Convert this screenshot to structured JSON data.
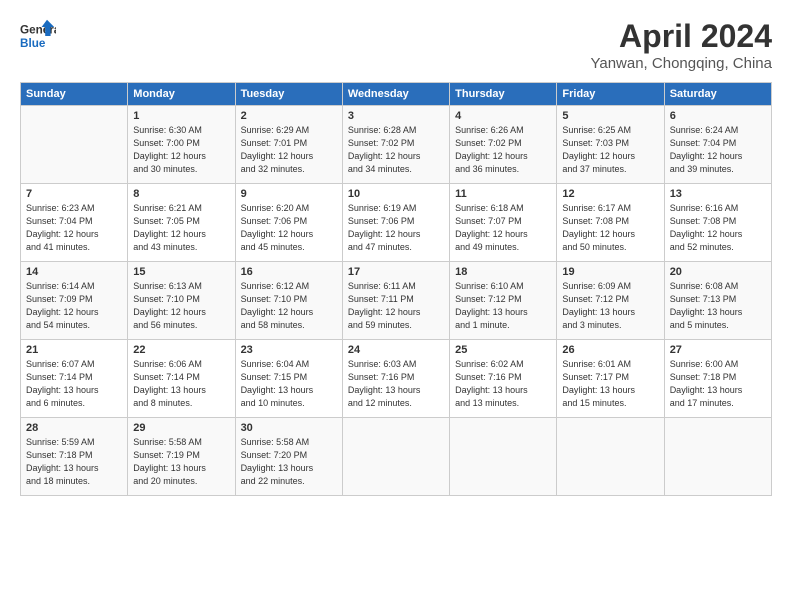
{
  "header": {
    "logo_line1": "General",
    "logo_line2": "Blue",
    "title": "April 2024",
    "subtitle": "Yanwan, Chongqing, China"
  },
  "columns": [
    "Sunday",
    "Monday",
    "Tuesday",
    "Wednesday",
    "Thursday",
    "Friday",
    "Saturday"
  ],
  "weeks": [
    [
      {
        "day": "",
        "info": ""
      },
      {
        "day": "1",
        "info": "Sunrise: 6:30 AM\nSunset: 7:00 PM\nDaylight: 12 hours\nand 30 minutes."
      },
      {
        "day": "2",
        "info": "Sunrise: 6:29 AM\nSunset: 7:01 PM\nDaylight: 12 hours\nand 32 minutes."
      },
      {
        "day": "3",
        "info": "Sunrise: 6:28 AM\nSunset: 7:02 PM\nDaylight: 12 hours\nand 34 minutes."
      },
      {
        "day": "4",
        "info": "Sunrise: 6:26 AM\nSunset: 7:02 PM\nDaylight: 12 hours\nand 36 minutes."
      },
      {
        "day": "5",
        "info": "Sunrise: 6:25 AM\nSunset: 7:03 PM\nDaylight: 12 hours\nand 37 minutes."
      },
      {
        "day": "6",
        "info": "Sunrise: 6:24 AM\nSunset: 7:04 PM\nDaylight: 12 hours\nand 39 minutes."
      }
    ],
    [
      {
        "day": "7",
        "info": "Sunrise: 6:23 AM\nSunset: 7:04 PM\nDaylight: 12 hours\nand 41 minutes."
      },
      {
        "day": "8",
        "info": "Sunrise: 6:21 AM\nSunset: 7:05 PM\nDaylight: 12 hours\nand 43 minutes."
      },
      {
        "day": "9",
        "info": "Sunrise: 6:20 AM\nSunset: 7:06 PM\nDaylight: 12 hours\nand 45 minutes."
      },
      {
        "day": "10",
        "info": "Sunrise: 6:19 AM\nSunset: 7:06 PM\nDaylight: 12 hours\nand 47 minutes."
      },
      {
        "day": "11",
        "info": "Sunrise: 6:18 AM\nSunset: 7:07 PM\nDaylight: 12 hours\nand 49 minutes."
      },
      {
        "day": "12",
        "info": "Sunrise: 6:17 AM\nSunset: 7:08 PM\nDaylight: 12 hours\nand 50 minutes."
      },
      {
        "day": "13",
        "info": "Sunrise: 6:16 AM\nSunset: 7:08 PM\nDaylight: 12 hours\nand 52 minutes."
      }
    ],
    [
      {
        "day": "14",
        "info": "Sunrise: 6:14 AM\nSunset: 7:09 PM\nDaylight: 12 hours\nand 54 minutes."
      },
      {
        "day": "15",
        "info": "Sunrise: 6:13 AM\nSunset: 7:10 PM\nDaylight: 12 hours\nand 56 minutes."
      },
      {
        "day": "16",
        "info": "Sunrise: 6:12 AM\nSunset: 7:10 PM\nDaylight: 12 hours\nand 58 minutes."
      },
      {
        "day": "17",
        "info": "Sunrise: 6:11 AM\nSunset: 7:11 PM\nDaylight: 12 hours\nand 59 minutes."
      },
      {
        "day": "18",
        "info": "Sunrise: 6:10 AM\nSunset: 7:12 PM\nDaylight: 13 hours\nand 1 minute."
      },
      {
        "day": "19",
        "info": "Sunrise: 6:09 AM\nSunset: 7:12 PM\nDaylight: 13 hours\nand 3 minutes."
      },
      {
        "day": "20",
        "info": "Sunrise: 6:08 AM\nSunset: 7:13 PM\nDaylight: 13 hours\nand 5 minutes."
      }
    ],
    [
      {
        "day": "21",
        "info": "Sunrise: 6:07 AM\nSunset: 7:14 PM\nDaylight: 13 hours\nand 6 minutes."
      },
      {
        "day": "22",
        "info": "Sunrise: 6:06 AM\nSunset: 7:14 PM\nDaylight: 13 hours\nand 8 minutes."
      },
      {
        "day": "23",
        "info": "Sunrise: 6:04 AM\nSunset: 7:15 PM\nDaylight: 13 hours\nand 10 minutes."
      },
      {
        "day": "24",
        "info": "Sunrise: 6:03 AM\nSunset: 7:16 PM\nDaylight: 13 hours\nand 12 minutes."
      },
      {
        "day": "25",
        "info": "Sunrise: 6:02 AM\nSunset: 7:16 PM\nDaylight: 13 hours\nand 13 minutes."
      },
      {
        "day": "26",
        "info": "Sunrise: 6:01 AM\nSunset: 7:17 PM\nDaylight: 13 hours\nand 15 minutes."
      },
      {
        "day": "27",
        "info": "Sunrise: 6:00 AM\nSunset: 7:18 PM\nDaylight: 13 hours\nand 17 minutes."
      }
    ],
    [
      {
        "day": "28",
        "info": "Sunrise: 5:59 AM\nSunset: 7:18 PM\nDaylight: 13 hours\nand 18 minutes."
      },
      {
        "day": "29",
        "info": "Sunrise: 5:58 AM\nSunset: 7:19 PM\nDaylight: 13 hours\nand 20 minutes."
      },
      {
        "day": "30",
        "info": "Sunrise: 5:58 AM\nSunset: 7:20 PM\nDaylight: 13 hours\nand 22 minutes."
      },
      {
        "day": "",
        "info": ""
      },
      {
        "day": "",
        "info": ""
      },
      {
        "day": "",
        "info": ""
      },
      {
        "day": "",
        "info": ""
      }
    ]
  ]
}
